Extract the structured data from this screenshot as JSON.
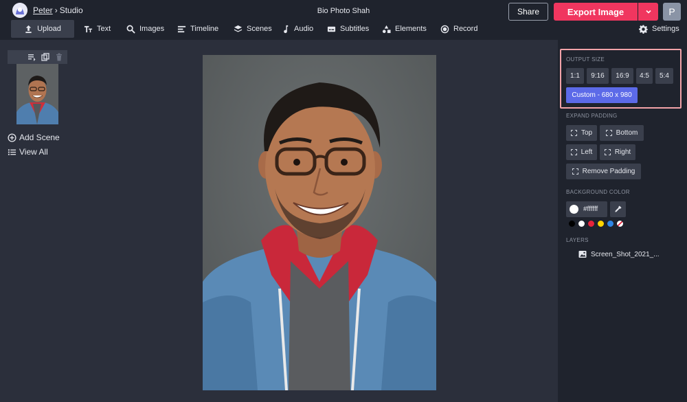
{
  "header": {
    "user": "Peter",
    "separator": "›",
    "section": "Studio",
    "doc_title": "Bio Photo Shah",
    "share_label": "Share",
    "export_label": "Export Image",
    "avatar_initial": "P"
  },
  "toolbar": {
    "upload": "Upload",
    "text": "Text",
    "images": "Images",
    "timeline": "Timeline",
    "scenes": "Scenes",
    "audio": "Audio",
    "subtitles": "Subtitles",
    "elements": "Elements",
    "record": "Record",
    "settings": "Settings"
  },
  "left_panel": {
    "add_scene": "Add Scene",
    "view_all": "View All"
  },
  "right_panel": {
    "output_size_label": "OUTPUT SIZE",
    "sizes": [
      "1:1",
      "9:16",
      "16:9",
      "4:5",
      "5:4"
    ],
    "custom_size": "Custom - 680 x 980",
    "expand_padding_label": "EXPAND PADDING",
    "padding": {
      "top": "Top",
      "bottom": "Bottom",
      "left": "Left",
      "right": "Right",
      "remove": "Remove Padding"
    },
    "background_color_label": "BACKGROUND COLOR",
    "background_color": "#ffffff",
    "palette": [
      "#000000",
      "#ffffff",
      "#e8243c",
      "#ffd400",
      "#2f86e6"
    ],
    "layers_label": "LAYERS",
    "layer_name": "Screen_Shot_2021_..."
  },
  "colors": {
    "accent": "#f0365f",
    "active": "#5c6ae8",
    "highlight": "#f3a3a9"
  }
}
